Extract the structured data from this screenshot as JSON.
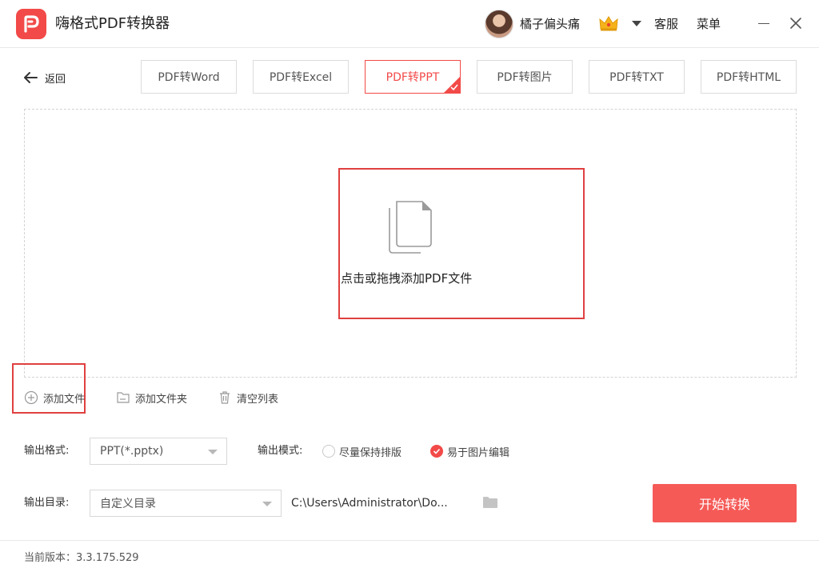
{
  "app": {
    "title": "嗨格式PDF转换器",
    "brand_color": "#f24a48",
    "logo_icon": "app-logo-icon"
  },
  "header": {
    "username": "橘子偏头痛",
    "vip_icon": "crown-icon",
    "support_label": "客服",
    "menu_label": "菜单"
  },
  "nav": {
    "back_label": "返回",
    "tabs": [
      {
        "label": "PDF转Word",
        "active": false
      },
      {
        "label": "PDF转Excel",
        "active": false
      },
      {
        "label": "PDF转PPT",
        "active": true
      },
      {
        "label": "PDF转图片",
        "active": false
      },
      {
        "label": "PDF转TXT",
        "active": false
      },
      {
        "label": "PDF转HTML",
        "active": false
      }
    ]
  },
  "dropzone": {
    "prompt": "点击或拖拽添加PDF文件",
    "icon": "files-icon"
  },
  "actions": {
    "add_file": "添加文件",
    "add_folder": "添加文件夹",
    "clear_list": "清空列表"
  },
  "settings": {
    "format_label": "输出格式:",
    "format_value": "PPT(*.pptx)",
    "mode_label": "输出模式:",
    "mode_options": [
      {
        "label": "尽量保持排版",
        "checked": false
      },
      {
        "label": "易于图片编辑",
        "checked": true
      }
    ],
    "dir_label": "输出目录:",
    "dir_value": "自定义目录",
    "dir_path": "C:\\Users\\Administrator\\Do...",
    "start_label": "开始转换"
  },
  "footer": {
    "version_text": "当前版本：3.3.175.529"
  }
}
